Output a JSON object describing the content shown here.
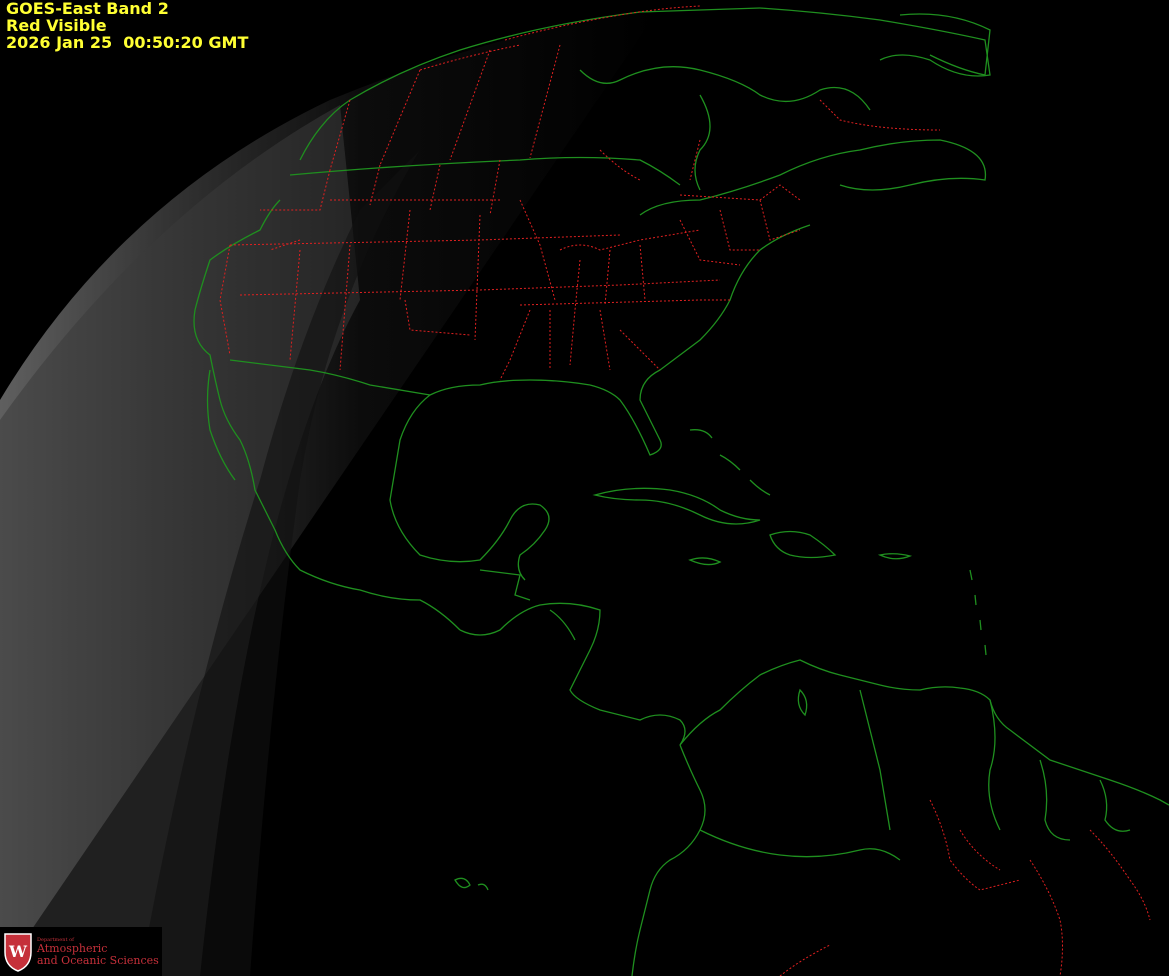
{
  "title": {
    "line1": "GOES-East Band 2",
    "line2": "Red Visible",
    "line3": "2026 Jan 25  00:50:20 GMT"
  },
  "logo": {
    "shield_letter": "W",
    "department": "Department of",
    "line1": "Atmospheric",
    "line2": "and Oceanic Sciences"
  },
  "colors": {
    "overlay_text": "#ffff33",
    "coastline": "#1f8f1f",
    "state_border": "#e02020",
    "logo": "#c5303a"
  }
}
